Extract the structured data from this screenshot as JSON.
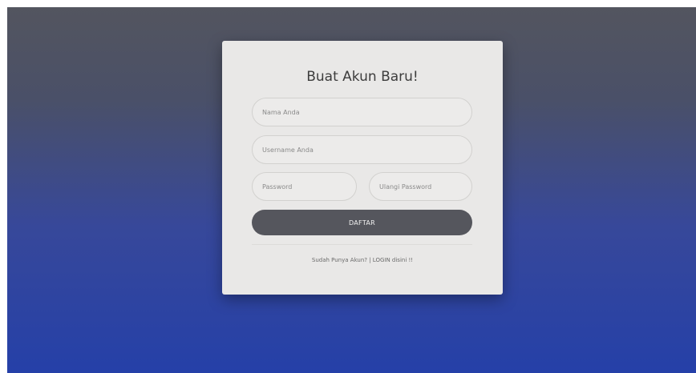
{
  "form": {
    "title": "Buat Akun Baru!",
    "nama_placeholder": "Nama Anda",
    "username_placeholder": "Username Anda",
    "password_placeholder": "Password",
    "ulang_password_placeholder": "Ulangi Password",
    "submit_label": "DAFTAR",
    "login_link": "Sudah Punya Akun? | LOGIN disini !!"
  },
  "colors": {
    "background_top": "#53555f",
    "background_bottom": "#2540a8",
    "card": "#e9e8e7",
    "button": "#55565d"
  }
}
